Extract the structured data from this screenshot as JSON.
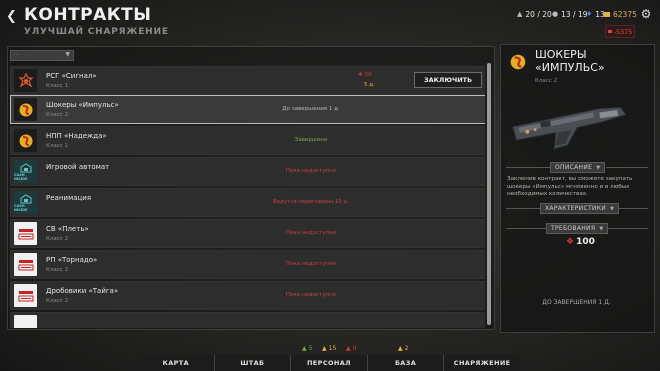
{
  "header": {
    "back_icon": "back-arrow-icon",
    "title": "КОНТРАКТЫ",
    "subtitle": "УЛУЧШАЙ СНАРЯЖЕНИЕ"
  },
  "resources": {
    "units": "20 / 20",
    "people": "13 / 19",
    "intel": "13",
    "money": "62375",
    "debt": "-5375"
  },
  "colors": {
    "accent_red": "#d63b3b",
    "status_green": "#7fa84a",
    "status_red": "#c94141",
    "money_gold": "#e3b53a",
    "intel_blue": "#4a7fd0"
  },
  "filter": {
    "value": "..."
  },
  "contracts": [
    {
      "name": "РСГ «Сигнал»",
      "class": "Класс 1",
      "logo": "signal-logo",
      "cost1": "50",
      "cost2": "5 д.",
      "action": "ЗАКЛЮЧИТЬ"
    },
    {
      "name": "Шокеры «Импульс»",
      "class": "Класс 2",
      "logo": "impulse-logo",
      "status": "До завершения 1 д."
    },
    {
      "name": "НПП «Надежда»",
      "class": "Класс 1",
      "logo": "nadezhda-logo",
      "status": "Завершено"
    },
    {
      "name": "Игровой автомат",
      "class": "",
      "logo": "cash-inside-logo",
      "logo_text": "CASH INSIDE",
      "status": "Пока недоступно"
    },
    {
      "name": "Реанимация",
      "class": "",
      "logo": "cash-inside-logo",
      "logo_text": "CASH INSIDE",
      "status": "Ведутся переговоры 10 д."
    },
    {
      "name": "СВ «Плеть»",
      "class": "Класс 2",
      "logo": "gun-brand-logo",
      "status": "Пока недоступно"
    },
    {
      "name": "РП «Торнадо»",
      "class": "Класс 2",
      "logo": "gun-brand-logo",
      "status": "Пока недоступно"
    },
    {
      "name": "Дробовики «Тайга»",
      "class": "Класс 2",
      "logo": "gun-brand-logo",
      "status": "Пока недоступно"
    }
  ],
  "detail": {
    "name": "ШОКЕРЫ «ИМПУЛЬС»",
    "class": "Класс 2",
    "description_tag": "ОПИСАНИЕ",
    "description": "Заключив контракт, вы сможете закупать шокеры «Импульс» мгновенно и в любых необходимых количествах.",
    "features_tag": "ХАРАКТЕРИСТИКИ",
    "requirements_tag": "ТРЕБОВАНИЯ",
    "price": "100",
    "until": "ДО ЗАВЕРШЕНИЯ 1 Д."
  },
  "bottom_nav": {
    "tabs": [
      "КАРТА",
      "ШТАБ",
      "ПЕРСОНАЛ",
      "БАЗА",
      "СНАРЯЖЕНИЕ"
    ],
    "badge_green": "5",
    "badge_gold": "15",
    "badge_red": "0",
    "badge_base": "2"
  }
}
